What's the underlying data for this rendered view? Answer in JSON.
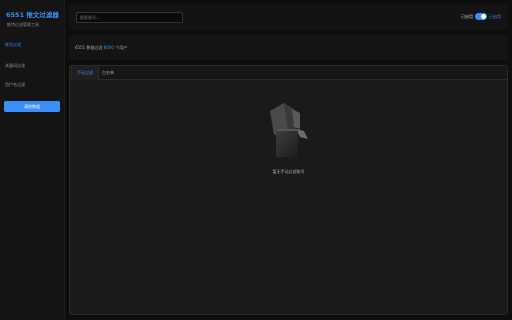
{
  "sidebar": {
    "title": "6551 推文过滤器",
    "subtitle": "推特过滤管理工具",
    "items": [
      {
        "label": "账号过滤",
        "active": true
      },
      {
        "label": "关键词过滤",
        "active": false
      },
      {
        "label": "用户名过滤",
        "active": false
      }
    ],
    "clear_button": "清除数据"
  },
  "topbar": {
    "search_placeholder": "搜索账号...",
    "toggle_left_label": "已启用",
    "toggle_right_label": "已启用",
    "toggle_on": true
  },
  "info": {
    "prefix": "6551 数据过滤 ",
    "count": "8000",
    "suffix": " 个用户"
  },
  "tabs": [
    {
      "label": "手动过滤",
      "active": true
    },
    {
      "label": "白名单",
      "active": false
    }
  ],
  "empty_state": {
    "text": "暂无手动过滤账号",
    "icon": "empty-box-icon"
  },
  "colors": {
    "accent": "#3b8ef7",
    "background": "#0e0e0e",
    "panel": "#1a1a1a"
  }
}
